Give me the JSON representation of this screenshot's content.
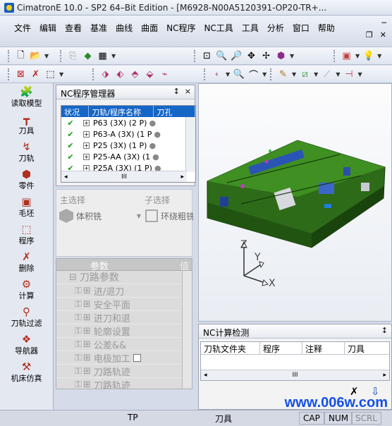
{
  "window": {
    "title": "CimatronE 10.0 - SP2 64–Bit Edition - [M6928-N00A5120391-OP20-TR+..."
  },
  "menu": [
    "文件",
    "编辑",
    "查看",
    "基准",
    "曲线",
    "曲面",
    "NC程序",
    "NC工具",
    "工具",
    "分析",
    "窗口",
    "帮助"
  ],
  "side_items": [
    {
      "label": "读取模型",
      "icon": "load-model-icon"
    },
    {
      "label": "刀具",
      "icon": "tool-icon"
    },
    {
      "label": "刀轨",
      "icon": "toolpath-icon"
    },
    {
      "label": "零件",
      "icon": "part-icon"
    },
    {
      "label": "毛坯",
      "icon": "stock-icon"
    },
    {
      "label": "程序",
      "icon": "program-icon"
    },
    {
      "label": "删除",
      "icon": "delete-icon"
    },
    {
      "label": "计算",
      "icon": "compute-icon"
    },
    {
      "label": "刀轨过滤",
      "icon": "filter-icon"
    },
    {
      "label": "导航器",
      "icon": "navigator-icon"
    },
    {
      "label": "机床仿真",
      "icon": "machine-sim-icon"
    }
  ],
  "nc_manager": {
    "title": "NC程序管理器",
    "pin": "↕",
    "close": "×",
    "columns": [
      "状况",
      "刀轨/程序名称",
      "刀孔"
    ],
    "rows": [
      {
        "name": "P63 (3X) (2 P)"
      },
      {
        "name": "P63-A (3X) (1 P"
      },
      {
        "name": "P25 (3X) (1 P)"
      },
      {
        "name": "P25-AA (3X) (1"
      },
      {
        "name": "P25A (3X) (1 P)"
      }
    ],
    "scroll_mid": "III"
  },
  "selection": {
    "main_label": "主选择",
    "sub_label": "子选择",
    "main_value": "体积铣",
    "sub_value": "环绕粗铣"
  },
  "params": {
    "header": "参数",
    "header2": "值",
    "rows": [
      "刀路参数",
      "进/退刀",
      "安全平面",
      "进刀和退",
      "轮廓设置",
      "公差&&",
      "电极加工",
      "刀路轨迹",
      "刀路轨迹"
    ]
  },
  "triad": {
    "x": "X",
    "y": "Y",
    "z": "Z"
  },
  "nc_calc": {
    "title": "NC计算检测",
    "columns": [
      "刀轨文件夹",
      "程序",
      "注释",
      "刀具"
    ],
    "scroll_mid": "III"
  },
  "status": {
    "cell1": "TP",
    "cell2": "刀具",
    "cap": "CAP",
    "num": "NUM",
    "scrl": "SCRL"
  },
  "watermark": "www.006w.com"
}
